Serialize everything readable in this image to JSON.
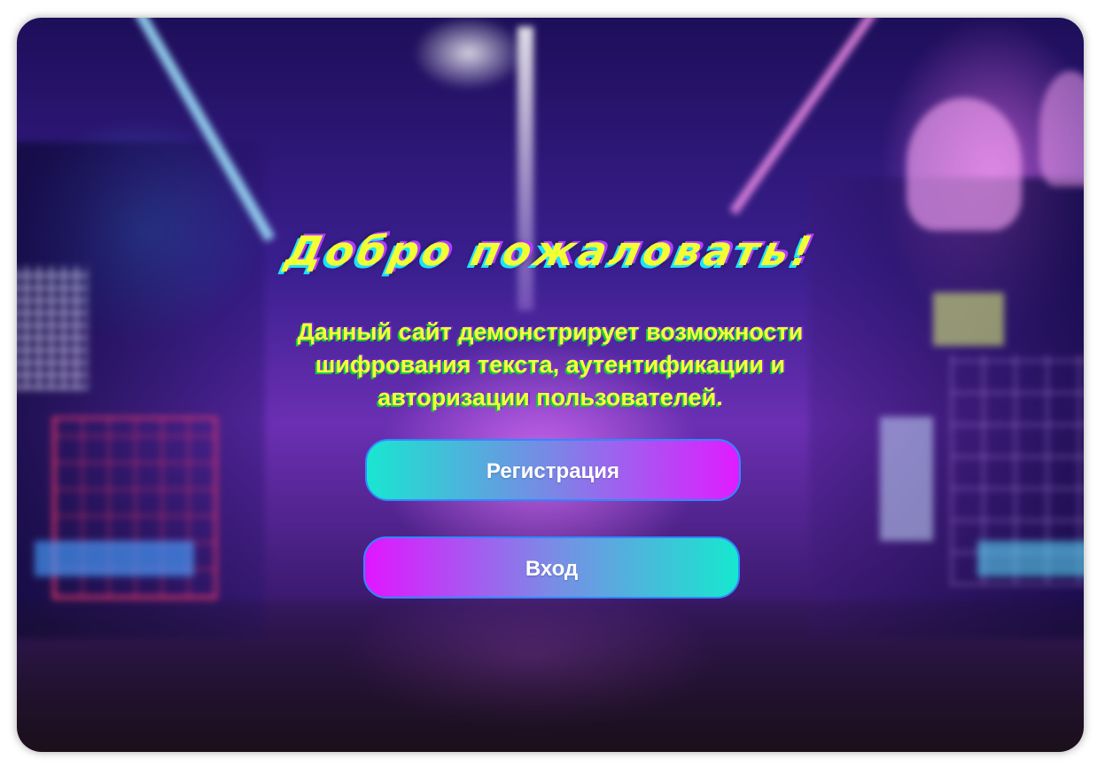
{
  "hero": {
    "title": "Добро пожаловать!",
    "description": "Данный сайт демонстрирует возможности шифрования текста, аутентификации и авторизации пользователей."
  },
  "actions": {
    "register_label": "Регистрация",
    "login_label": "Вход"
  },
  "colors": {
    "title_text": "#f2ff33",
    "title_shadow_cyan": "#19e3ff",
    "description_text": "#f5ff3a",
    "description_shadow": "#14c93c",
    "button_border": "#2f88ff",
    "gradient_cyan": "#19e6d0",
    "gradient_magenta": "#e01cff"
  }
}
